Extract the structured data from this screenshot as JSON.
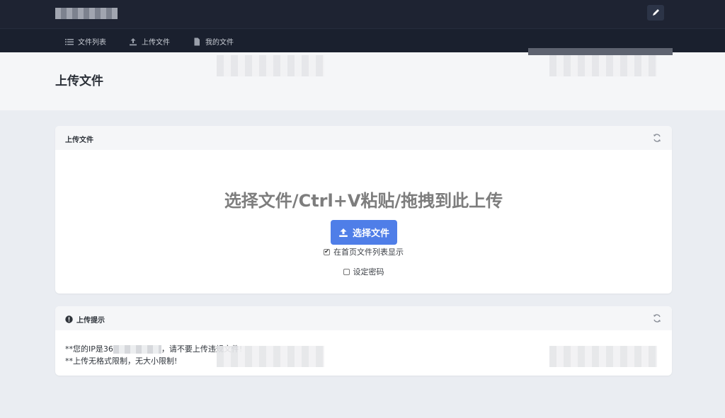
{
  "nav": {
    "items": [
      {
        "label": "文件列表",
        "icon": "list-icon"
      },
      {
        "label": "上传文件",
        "icon": "upload-icon"
      },
      {
        "label": "我的文件",
        "icon": "file-icon"
      }
    ]
  },
  "page": {
    "title": "上传文件"
  },
  "upload_card": {
    "title": "上传文件",
    "drop_text": "选择文件/Ctrl+V粘贴/拖拽到此上传",
    "select_button": "选择文件",
    "options": [
      {
        "label": "在首页文件列表显示",
        "checked": true
      },
      {
        "label": "设定密码",
        "checked": false
      }
    ]
  },
  "tips_card": {
    "title": "上传提示",
    "ip_prefix": "**您的IP是36",
    "ip_suffix": "，请不要上传违规文件!",
    "line2": "**上传无格式限制，无大小限制!"
  },
  "colors": {
    "topbar": "#1e2332",
    "accent": "#4f7ee8"
  }
}
